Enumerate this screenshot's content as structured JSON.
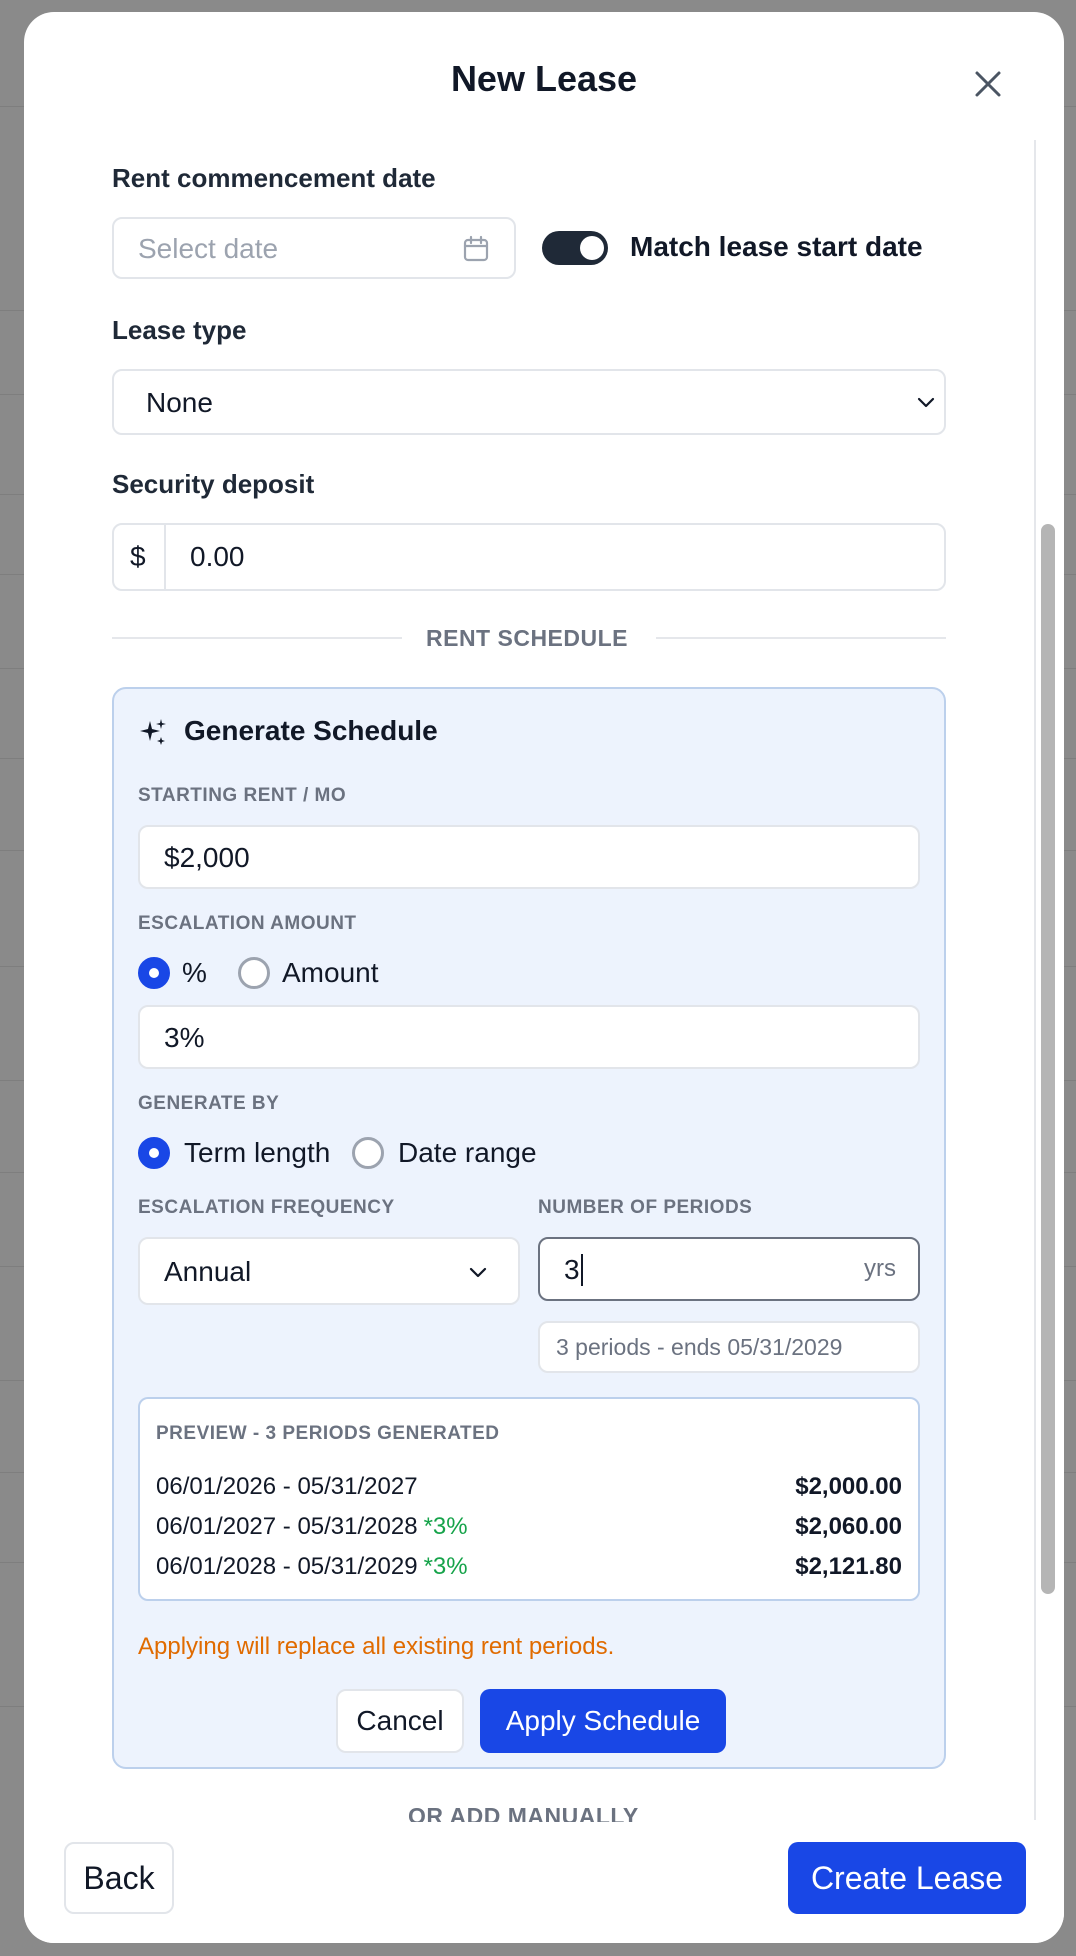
{
  "modal": {
    "title": "New Lease"
  },
  "rent_commencement": {
    "label": "Rent commencement date",
    "placeholder": "Select date",
    "toggle_label": "Match lease start date",
    "toggle_on": true
  },
  "lease_type": {
    "label": "Lease type",
    "value": "None"
  },
  "security_deposit": {
    "label": "Security deposit",
    "prefix": "$",
    "value": "0.00"
  },
  "rent_schedule_divider": "RENT SCHEDULE",
  "generate_schedule": {
    "title": "Generate Schedule",
    "starting_rent_label": "STARTING RENT / MO",
    "starting_rent_value": "$2,000",
    "escalation_amount_label": "ESCALATION AMOUNT",
    "escalation_options": [
      "%",
      "Amount"
    ],
    "escalation_selected": "%",
    "escalation_value": "3%",
    "generate_by_label": "GENERATE BY",
    "generate_by_options": [
      "Term length",
      "Date range"
    ],
    "generate_by_selected": "Term length",
    "frequency_label": "ESCALATION FREQUENCY",
    "frequency_value": "Annual",
    "periods_label": "NUMBER OF PERIODS",
    "periods_value": "3",
    "periods_unit": "yrs",
    "periods_hint": "3 periods - ends 05/31/2029",
    "preview_title": "PREVIEW - 3 PERIODS GENERATED",
    "preview_rows": [
      {
        "range": "06/01/2026 - 05/31/2027",
        "escalation": "",
        "amount": "$2,000.00"
      },
      {
        "range": "06/01/2027 - 05/31/2028",
        "escalation": "*3%",
        "amount": "$2,060.00"
      },
      {
        "range": "06/01/2028 - 05/31/2029",
        "escalation": "*3%",
        "amount": "$2,121.80"
      }
    ],
    "warning": "Applying will replace all existing rent periods.",
    "cancel_label": "Cancel",
    "apply_label": "Apply Schedule"
  },
  "or_add_manually": "OR ADD MANUALLY",
  "footer": {
    "back_label": "Back",
    "create_label": "Create Lease"
  },
  "colors": {
    "primary": "#1947e6",
    "panel_bg": "#edf3fd",
    "warning": "#e06b00",
    "escalation_green": "#16a34a"
  }
}
